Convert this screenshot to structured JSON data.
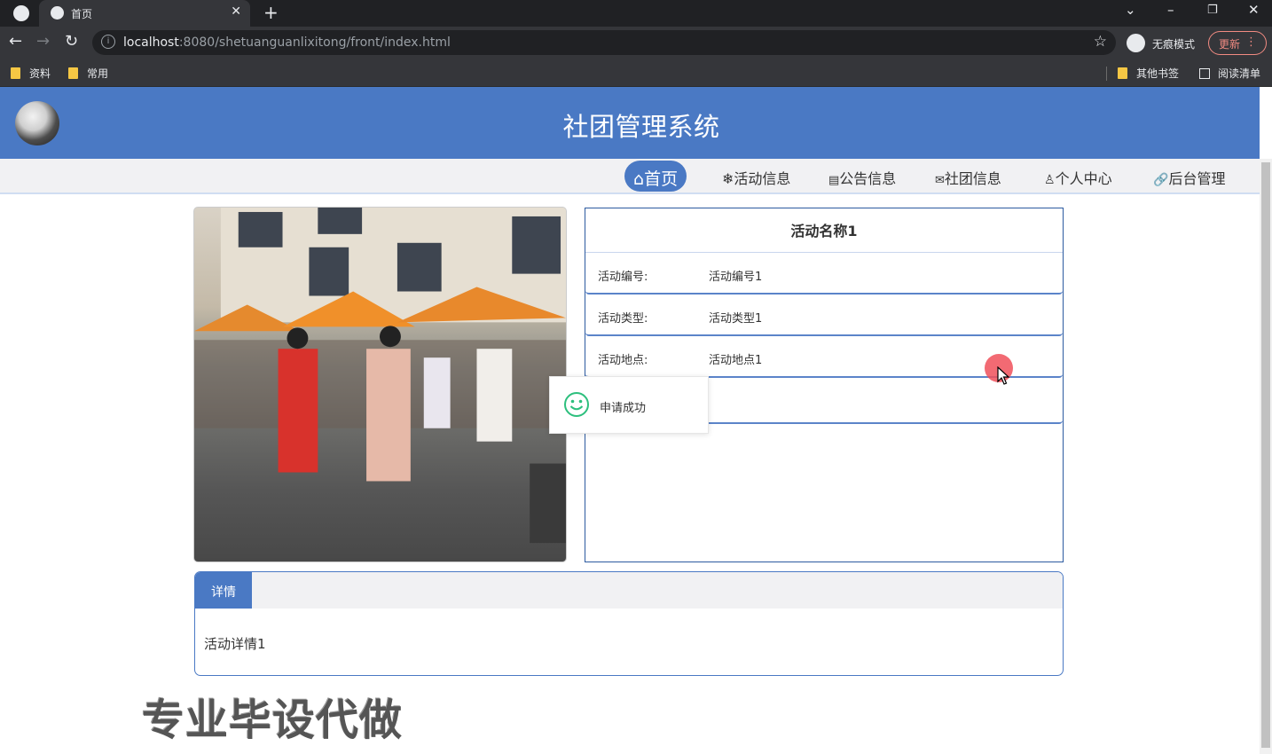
{
  "browser": {
    "tab_title": "首页",
    "url_host": "localhost",
    "url_rest": ":8080/shetuanguanlixitong/front/index.html",
    "incognito_label": "无痕模式",
    "update_label": "更新",
    "bookmarks": [
      "资料",
      "常用"
    ],
    "bookmarks_right": [
      "其他书签",
      "阅读清单"
    ]
  },
  "site": {
    "title": "社团管理系统",
    "nav": [
      {
        "label": "首页",
        "icon": "home-icon",
        "active": true
      },
      {
        "label": "活动信息",
        "icon": "snowflake-icon"
      },
      {
        "label": "公告信息",
        "icon": "clipboard-icon"
      },
      {
        "label": "社团信息",
        "icon": "envelope-icon"
      },
      {
        "label": "个人中心",
        "icon": "user-icon"
      },
      {
        "label": "后台管理",
        "icon": "link-icon"
      }
    ]
  },
  "activity": {
    "name": "活动名称1",
    "fields": [
      {
        "label": "活动编号:",
        "value": "活动编号1"
      },
      {
        "label": "活动类型:",
        "value": "活动类型1"
      },
      {
        "label": "活动地点:",
        "value": "活动地点1"
      }
    ]
  },
  "toast": {
    "message": "申请成功"
  },
  "detail": {
    "tab_label": "详情",
    "content": "活动详情1"
  },
  "watermark": "专业毕设代做",
  "colors": {
    "primary": "#4a79c4",
    "tabbar": "#202124",
    "toolbar": "#35363a"
  }
}
